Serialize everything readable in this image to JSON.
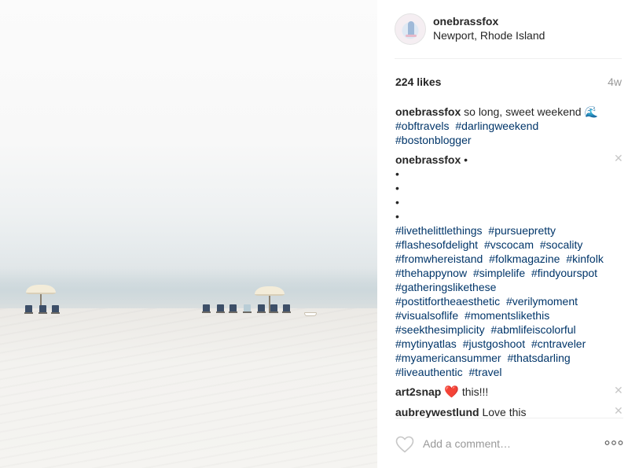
{
  "post": {
    "username": "onebrassfox",
    "location": "Newport, Rhode Island",
    "likes": "224 likes",
    "age": "4w"
  },
  "caption": {
    "author": "onebrassfox",
    "text": "so long, sweet weekend",
    "emoji": "🌊",
    "tags": [
      "#obftravels",
      "#darlingweekend",
      "#bostonblogger"
    ]
  },
  "comments": [
    {
      "author": "onebrassfox",
      "first_line": "•",
      "bullets": [
        "•",
        "•",
        "•",
        "•"
      ],
      "tags": [
        "#livethelittlethings",
        "#pursuepretty",
        "#flashesofdelight",
        "#vscocam",
        "#socality",
        "#fromwhereistand",
        "#folkmagazine",
        "#kinfolk",
        "#thehappynow",
        "#simplelife",
        "#findyourspot",
        "#gatheringslikethese",
        "#postitfortheaesthetic",
        "#verilymoment",
        "#visualsoflife",
        "#momentslikethis",
        "#seekthesimplicity",
        "#abmlifeiscolorful",
        "#mytinyatlas",
        "#justgoshoot",
        "#cntraveler",
        "#myamericansummer",
        "#thatsdarling",
        "#liveauthentic",
        "#travel"
      ]
    },
    {
      "author": "art2snap",
      "emoji": "❤️",
      "text": "this!!!"
    },
    {
      "author": "aubreywestlund",
      "text": "Love this"
    }
  ],
  "footer": {
    "comment_placeholder": "Add a comment…",
    "like_icon": "heart-outline-icon",
    "more_icon": "ellipsis-icon"
  },
  "colors": {
    "hashtag": "#003569",
    "muted": "#999999",
    "divider": "#efefef"
  }
}
